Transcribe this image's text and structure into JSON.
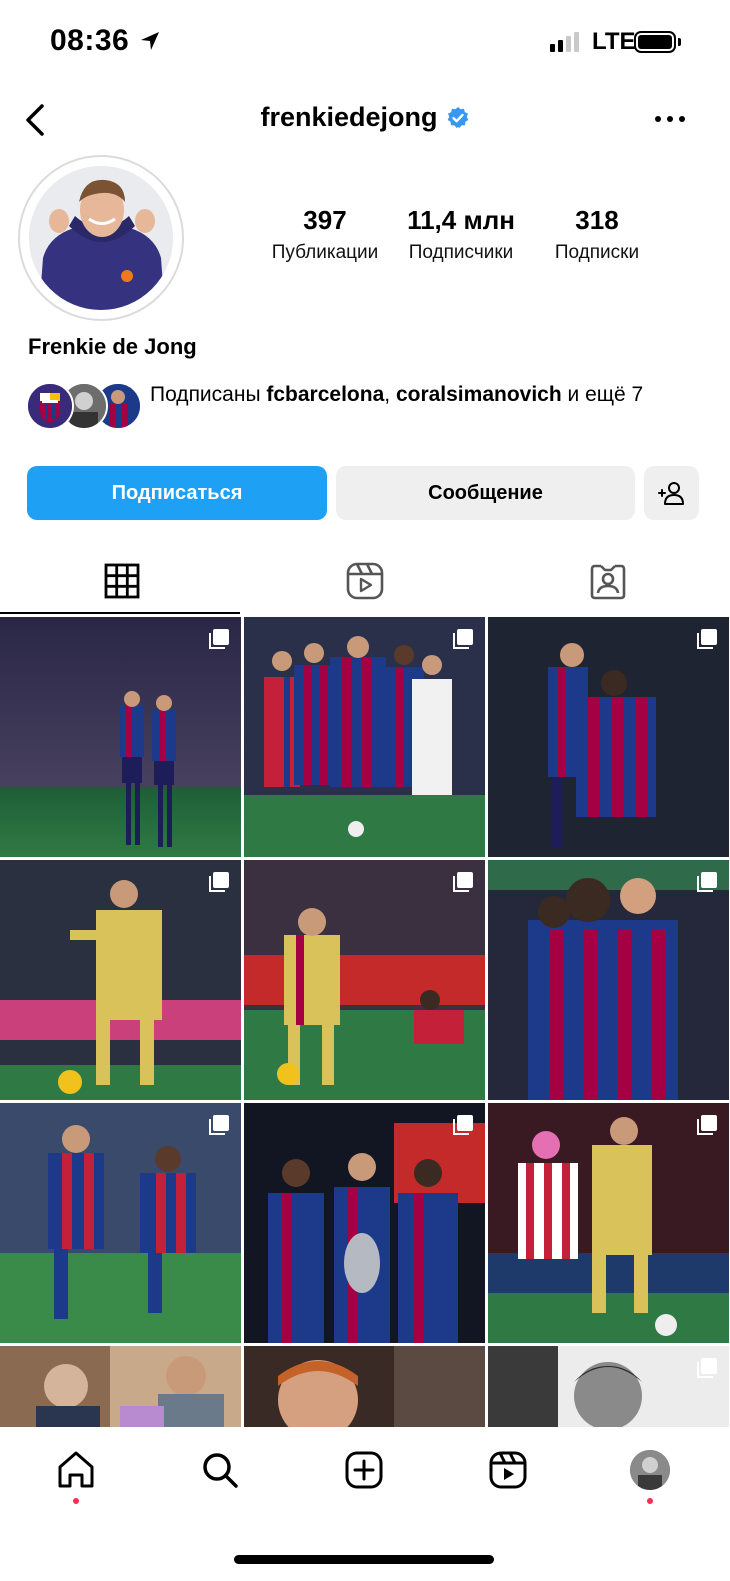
{
  "status_bar": {
    "time": "08:36",
    "network": "LTE"
  },
  "header": {
    "username": "frenkiedejong",
    "verified": true,
    "back_icon": "chevron-left-icon",
    "more_icon": "more-horizontal-icon"
  },
  "profile": {
    "full_name": "Frenkie de Jong",
    "stats": [
      {
        "value": "397",
        "label": "Публикации"
      },
      {
        "value": "11,4 млн",
        "label": "Подписчики"
      },
      {
        "value": "318",
        "label": "Подписки"
      }
    ],
    "followed_by": {
      "prefix": "Подписаны ",
      "account_1": "fcbarcelona",
      "separator": ", ",
      "account_2": "coralsimanovich",
      "suffix": " и ещё 7"
    }
  },
  "actions": {
    "follow_label": "Подписаться",
    "message_label": "Сообщение",
    "suggest_icon": "add-person-icon"
  },
  "tabs": [
    {
      "name": "grid",
      "icon": "grid-icon",
      "active": true
    },
    {
      "name": "reels",
      "icon": "reels-icon",
      "active": false
    },
    {
      "name": "tagged",
      "icon": "tagged-person-icon",
      "active": false
    }
  ],
  "grid_post_count_visible": 12,
  "bottom_nav": [
    {
      "name": "home",
      "icon": "home-icon",
      "notification_dot": true
    },
    {
      "name": "search",
      "icon": "search-icon",
      "notification_dot": false
    },
    {
      "name": "create",
      "icon": "plus-square-icon",
      "notification_dot": false
    },
    {
      "name": "reels",
      "icon": "reels-icon",
      "notification_dot": false
    },
    {
      "name": "profile",
      "icon": "profile-avatar",
      "notification_dot": true
    }
  ],
  "colors": {
    "accent_blue": "#1ea1f5",
    "verified_blue": "#3897f0",
    "secondary_button": "#efefef",
    "notification_dot": "#ff2a55",
    "barca_blue": "#1d3a8a",
    "barca_red": "#a50044",
    "away_kit_yellow": "#d9c25a"
  }
}
